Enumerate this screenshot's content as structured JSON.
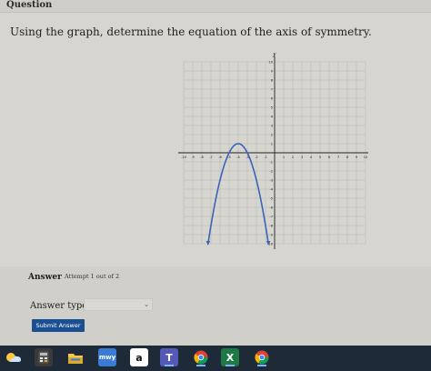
{
  "header": {
    "title": "Question"
  },
  "prompt": "Using the graph, determine the equation of the axis of symmetry.",
  "graph": {
    "x_axis_label": "x",
    "y_axis_label": "y",
    "x_ticks": [
      "-10",
      "-9",
      "-8",
      "-7",
      "-6",
      "-5",
      "-4",
      "-3",
      "-2",
      "-1",
      "1",
      "2",
      "3",
      "4",
      "5",
      "6",
      "7",
      "8",
      "9",
      "10"
    ],
    "y_ticks": [
      "10",
      "9",
      "8",
      "7",
      "6",
      "5",
      "4",
      "3",
      "2",
      "1",
      "-1",
      "-2",
      "-3",
      "-4",
      "-5",
      "-6",
      "-7",
      "-8",
      "-9",
      "-10"
    ],
    "parabola": {
      "vertex": [
        -4,
        1
      ],
      "a": -1,
      "opens": "down",
      "curve_color": "#3b63b8"
    }
  },
  "answer": {
    "label": "Answer",
    "attempt": "Attempt 1 out of 2",
    "type_label": "Answer type:",
    "type_value": "",
    "submit_label": "Submit Answer"
  },
  "taskbar": {
    "icons": [
      {
        "name": "weather-icon",
        "color": "#2b6fd6"
      },
      {
        "name": "calculator-icon",
        "color": "#3a3a3a"
      },
      {
        "name": "file-explorer-icon",
        "color": "#e6b53a"
      },
      {
        "name": "mathway-icon",
        "color": "#3a7bd5",
        "text": "mwy"
      },
      {
        "name": "amazon-icon",
        "color": "#ffffff",
        "text": "a"
      },
      {
        "name": "teams-icon",
        "color": "#5458b8",
        "text": "T"
      },
      {
        "name": "chrome-icon",
        "color": "#34a853"
      },
      {
        "name": "excel-icon",
        "color": "#1d7a44",
        "text": "X"
      },
      {
        "name": "chrome-profile-icon",
        "color": "#e8453c"
      }
    ]
  }
}
